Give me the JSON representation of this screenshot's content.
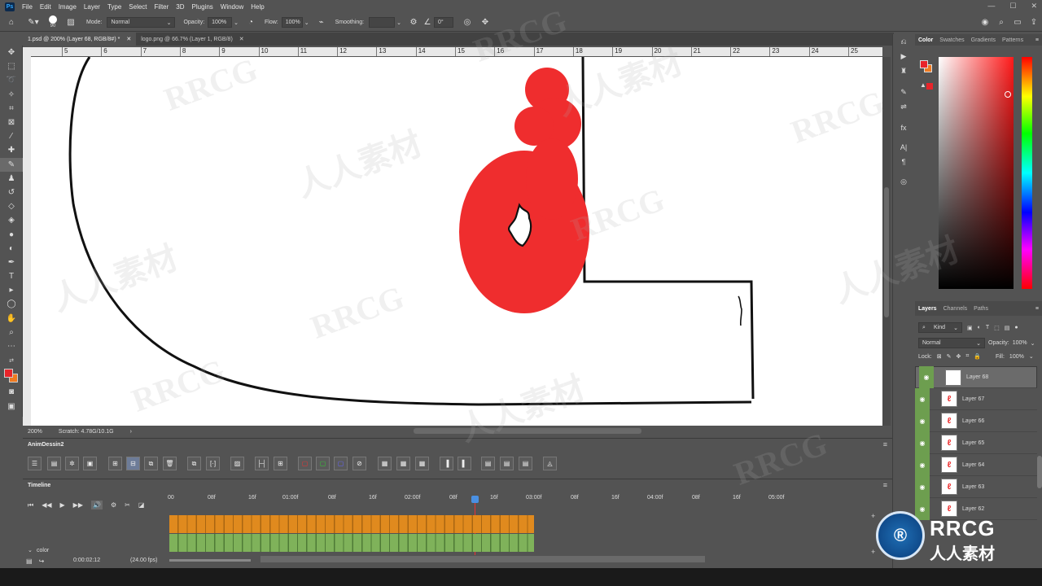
{
  "menu": [
    "File",
    "Edit",
    "Image",
    "Layer",
    "Type",
    "Select",
    "Filter",
    "3D",
    "Plugins",
    "Window",
    "Help"
  ],
  "app_badge": "Ps",
  "options": {
    "brush_size": "90",
    "mode_label": "Mode:",
    "mode_value": "Normal",
    "opacity_label": "Opacity:",
    "opacity_value": "100%",
    "flow_label": "Flow:",
    "flow_value": "100%",
    "smoothing_label": "Smoothing:",
    "angle_value": "0°"
  },
  "tabs": [
    {
      "label": "1.psd @ 200% (Layer 68, RGB/8#) *"
    },
    {
      "label": "logo.png @ 66.7% (Layer 1, RGB/8)"
    }
  ],
  "ruler": {
    "marks": [
      "5",
      "6",
      "7",
      "8",
      "9",
      "10",
      "11",
      "12",
      "13",
      "14",
      "15",
      "16",
      "17",
      "18",
      "19",
      "20",
      "21",
      "22",
      "23",
      "24",
      "25"
    ]
  },
  "status": {
    "zoom": "200%",
    "scratch": "Scratch: 4.78G/10.1G"
  },
  "anim_panel": {
    "title": "AnimDessin2"
  },
  "timeline": {
    "title": "Timeline",
    "ruler_labels": [
      "00",
      "08f",
      "16f",
      "01:00f",
      "08f",
      "16f",
      "02:00f",
      "08f",
      "16f",
      "03:00f",
      "08f",
      "16f",
      "04:00f",
      "08f",
      "16f",
      "05:00f"
    ],
    "track_label": "color",
    "timecode": "0:00:02:12",
    "fps": "(24.00 fps)"
  },
  "color_panel": {
    "tabs": [
      "Color",
      "Swatches",
      "Gradients",
      "Patterns"
    ],
    "foreground": "#e8242a",
    "background": "#f07a20"
  },
  "layers_panel": {
    "tabs": [
      "Layers",
      "Channels",
      "Paths"
    ],
    "filter_kind": "Kind",
    "blend_mode": "Normal",
    "opacity_label": "Opacity:",
    "opacity_value": "100%",
    "lock_label": "Lock:",
    "fill_label": "Fill:",
    "fill_value": "100%",
    "layers": [
      "Layer 68",
      "Layer 67",
      "Layer 66",
      "Layer 65",
      "Layer 64",
      "Layer 63",
      "Layer 62"
    ]
  },
  "watermark": {
    "main": "RRCG",
    "sub": "人人素材"
  }
}
